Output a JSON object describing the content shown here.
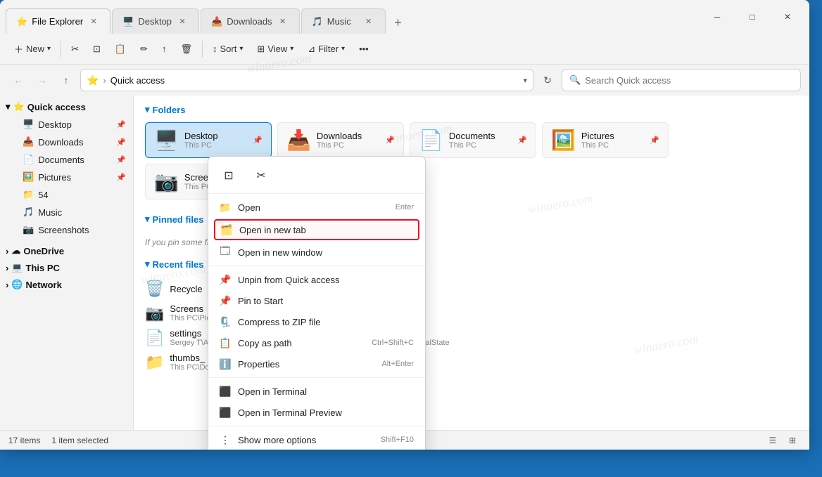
{
  "window": {
    "title": "File Explorer"
  },
  "tabs": [
    {
      "label": "File Explorer",
      "icon": "⭐",
      "active": true
    },
    {
      "label": "Desktop",
      "icon": "🖥️",
      "active": false
    },
    {
      "label": "Downloads",
      "icon": "📥",
      "active": false
    },
    {
      "label": "Music",
      "icon": "🎵",
      "active": false
    }
  ],
  "toolbar": {
    "new_label": "New",
    "cut_icon": "✂",
    "copy_icon": "⊡",
    "paste_icon": "📋",
    "rename_icon": "✏",
    "share_icon": "↑",
    "delete_icon": "🗑",
    "sort_label": "Sort",
    "view_label": "View",
    "filter_label": "Filter",
    "more_icon": "•••"
  },
  "addressbar": {
    "path_icon": "⭐",
    "path_text": "Quick access",
    "search_placeholder": "Search Quick access"
  },
  "sidebar": {
    "quick_access_label": "Quick access",
    "items": [
      {
        "label": "Desktop",
        "icon": "🖥️",
        "pinned": true
      },
      {
        "label": "Downloads",
        "icon": "📥",
        "pinned": true
      },
      {
        "label": "Documents",
        "icon": "📄",
        "pinned": true
      },
      {
        "label": "Pictures",
        "icon": "🖼️",
        "pinned": true
      },
      {
        "label": "54",
        "icon": "📁"
      },
      {
        "label": "Music",
        "icon": "🎵"
      },
      {
        "label": "Screenshots",
        "icon": "📷"
      }
    ],
    "onedrive_label": "OneDrive",
    "thispc_label": "This PC",
    "network_label": "Network"
  },
  "folders_section": {
    "title": "Folders",
    "items": [
      {
        "name": "Desktop",
        "sub": "This PC",
        "icon": "🖥️"
      },
      {
        "name": "Downloads",
        "sub": "This PC",
        "icon": "📥"
      },
      {
        "name": "Documents",
        "sub": "This PC",
        "icon": "📄"
      },
      {
        "name": "Pictures",
        "sub": "This PC",
        "icon": "🖼️"
      },
      {
        "name": "Screenshots",
        "sub": "This PC\\Pictures",
        "icon": "📷"
      }
    ]
  },
  "pinned_section": {
    "title": "Pinned files",
    "empty_text": "If you pin some files, we'll show them here."
  },
  "recent_section": {
    "title": "Recent files",
    "items": [
      {
        "name": "Recycle",
        "path": "",
        "icon": "🗑️"
      },
      {
        "name": "Screens",
        "path": "This PC\\Pictures\\Screenshots",
        "icon": "📷"
      },
      {
        "name": "settings",
        "path": "Sergey T\\AppData\\Local\\Packages\\Microsoft.WindowsTerminalPrevi...\\LocalState",
        "icon": "📄"
      },
      {
        "name": "thumbs_",
        "path": "This PC\\Downloads",
        "icon": "📁"
      }
    ]
  },
  "statusbar": {
    "items_count": "17 items",
    "selected_count": "1 item selected"
  },
  "context_menu": {
    "top_icons": [
      {
        "icon": "⊡",
        "label": "copy"
      },
      {
        "icon": "✂",
        "label": "cut"
      }
    ],
    "items": [
      {
        "label": "Open",
        "shortcut": "Enter",
        "icon": "📁"
      },
      {
        "label": "Open in new tab",
        "shortcut": "",
        "icon": "🗂️",
        "highlighted": true
      },
      {
        "label": "Open in new window",
        "shortcut": "",
        "icon": "🗔"
      },
      {
        "label": "Unpin from Quick access",
        "shortcut": "",
        "icon": "📌"
      },
      {
        "label": "Pin to Start",
        "shortcut": "",
        "icon": "📌"
      },
      {
        "label": "Compress to ZIP file",
        "shortcut": "",
        "icon": "🗜️"
      },
      {
        "label": "Copy as path",
        "shortcut": "Ctrl+Shift+C",
        "icon": "📋"
      },
      {
        "label": "Properties",
        "shortcut": "Alt+Enter",
        "icon": "ℹ️"
      },
      {
        "label": "Open in Terminal",
        "shortcut": "",
        "icon": "⬛"
      },
      {
        "label": "Open in Terminal Preview",
        "shortcut": "",
        "icon": "⬛"
      },
      {
        "label": "Show more options",
        "shortcut": "Shift+F10",
        "icon": "⋮"
      }
    ]
  }
}
